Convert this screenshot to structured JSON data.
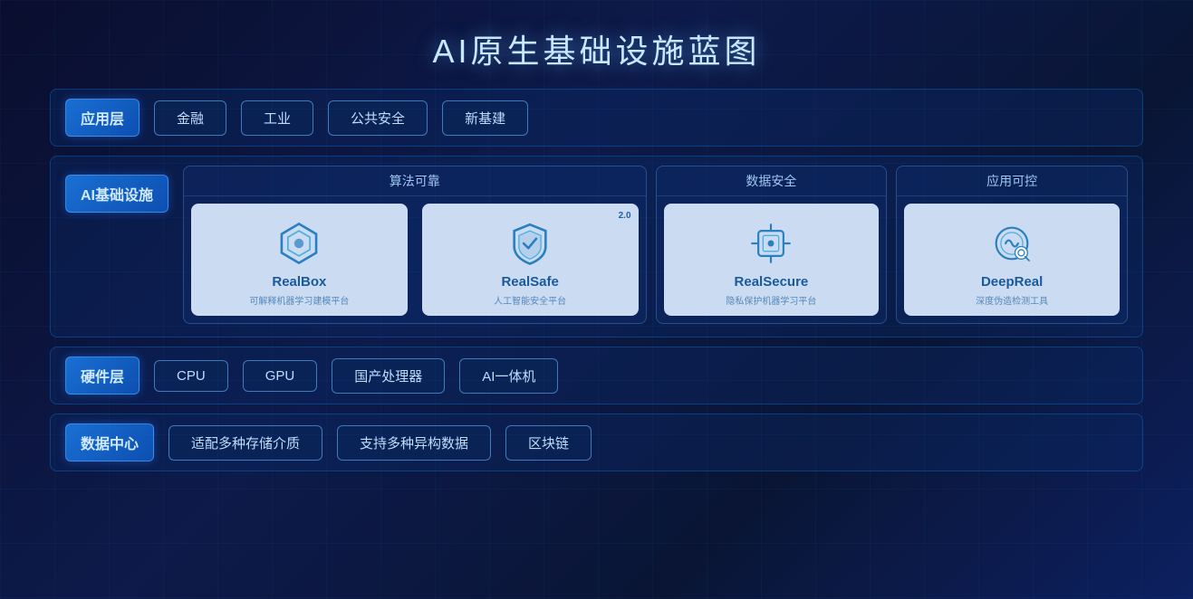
{
  "title": "AI原生基础设施蓝图",
  "layers": {
    "app": {
      "label": "应用层",
      "items": [
        "金融",
        "工业",
        "公共安全",
        "新基建"
      ]
    },
    "aiInfra": {
      "label": "AI基础设施",
      "sections": {
        "suanfaKaoKao": {
          "header": "算法可靠",
          "products": [
            {
              "name": "RealBox",
              "sub": "可解释机器学习建模平台",
              "version": ""
            },
            {
              "name": "RealSafe",
              "sub": "人工智能安全平台",
              "version": "2.0"
            }
          ]
        },
        "shujuAnquan": {
          "header": "数据安全",
          "products": [
            {
              "name": "RealSecure",
              "sub": "隐私保护机器学习平台",
              "version": ""
            }
          ]
        },
        "yingyongKekong": {
          "header": "应用可控",
          "products": [
            {
              "name": "DeepReal",
              "sub": "深度伪造检测工具",
              "version": ""
            }
          ]
        }
      }
    },
    "hardware": {
      "label": "硬件层",
      "items": [
        "CPU",
        "GPU",
        "国产处理器",
        "AI一体机"
      ]
    },
    "dataCenter": {
      "label": "数据中心",
      "items": [
        "适配多种存储介质",
        "支持多种异构数据",
        "区块链"
      ]
    }
  }
}
